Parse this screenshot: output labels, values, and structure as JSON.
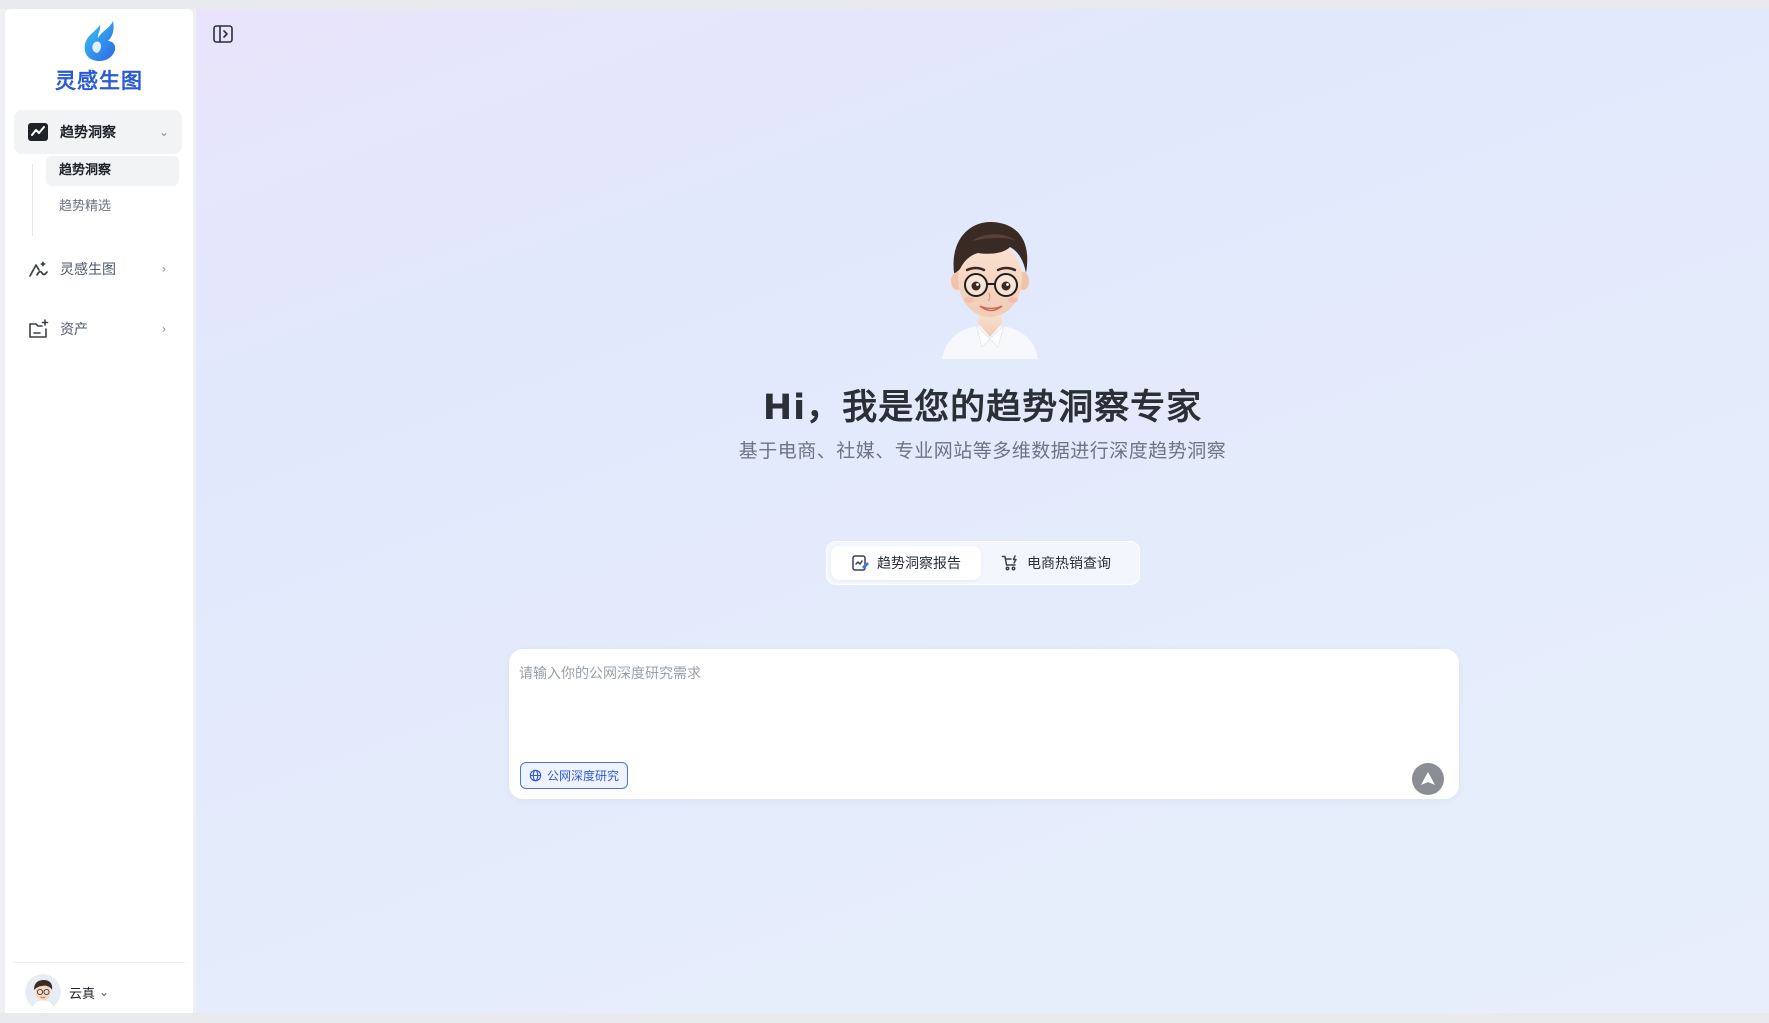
{
  "app": {
    "logo_text": "灵感生图"
  },
  "sidebar": {
    "groups": [
      {
        "label": "趋势洞察",
        "chevron": "⌄"
      },
      {
        "label": "灵感生图",
        "chevron": "›"
      },
      {
        "label": "资产",
        "chevron": "›"
      }
    ],
    "subitems": [
      {
        "label": "趋势洞察"
      },
      {
        "label": "趋势精选"
      }
    ],
    "user": {
      "name": "云真",
      "chevron": "⌄"
    }
  },
  "main": {
    "headline": "Hi，我是您的趋势洞察专家",
    "subheadline": "基于电商、社媒、专业网站等多维数据进行深度趋势洞察",
    "tabs": [
      {
        "label": "趋势洞察报告",
        "icon": "report-edit-icon"
      },
      {
        "label": "电商热销查询",
        "icon": "cart-icon"
      }
    ],
    "composer": {
      "placeholder": "请输入你的公网深度研究需求",
      "value": "",
      "chip_label": "公网深度研究"
    }
  },
  "colors": {
    "brand": "#2a5bd7",
    "chip": "#2f5bd8",
    "send": "#8a8d93"
  }
}
